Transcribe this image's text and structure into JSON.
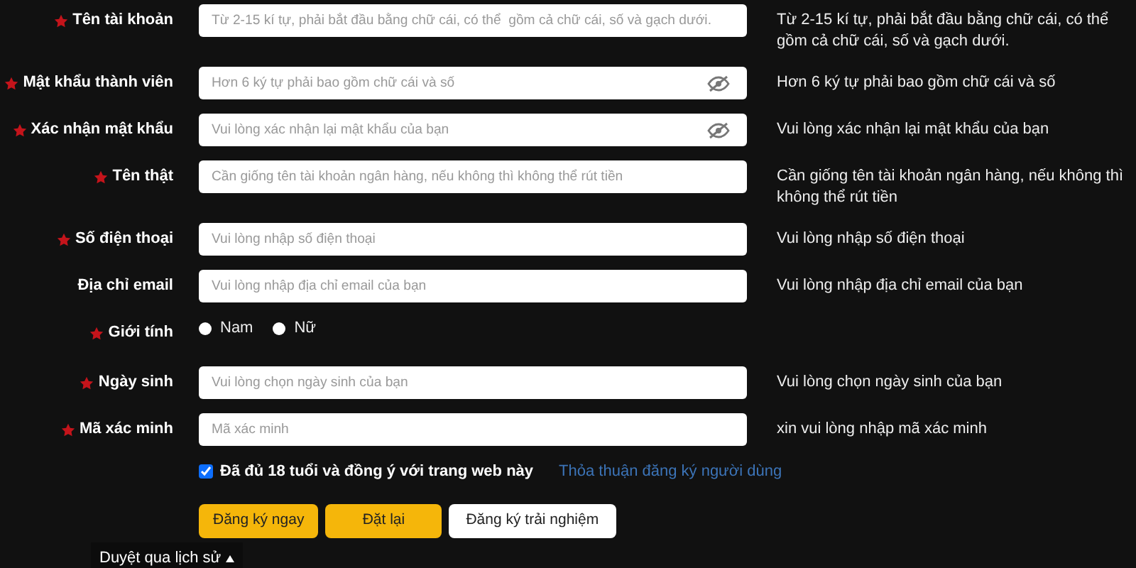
{
  "fields": [
    {
      "label": "Tên tài khoản",
      "required": true,
      "kind": "input",
      "placeholder": "Từ 2-15 kí tự, phải bắt đầu bằng chữ cái, có thể  gồm cả chữ cái, số và gạch dưới.",
      "hint": "Từ 2-15 kí tự, phải bắt đầu bằng chữ cái, có thể gồm cả chữ cái, số và gạch dưới."
    },
    {
      "label": "Mật khẩu thành viên",
      "required": true,
      "kind": "password",
      "placeholder": "Hơn 6 ký tự phải bao gồm chữ cái và số",
      "hint": "Hơn 6 ký tự phải bao gồm chữ cái và số"
    },
    {
      "label": "Xác nhận mật khẩu",
      "required": true,
      "kind": "password",
      "placeholder": "Vui lòng xác nhận lại mật khẩu của bạn",
      "hint": "Vui lòng xác nhận lại mật khẩu của bạn"
    },
    {
      "label": "Tên thật",
      "required": true,
      "kind": "input",
      "placeholder": "Cần giống tên tài khoản ngân hàng, nếu không thì không thể rút tiền",
      "hint": "Cần giống tên tài khoản ngân hàng, nếu không thì không thể rút tiền"
    },
    {
      "label": "Số điện thoại",
      "required": true,
      "kind": "input",
      "placeholder": "Vui lòng nhập số điện thoại",
      "hint": "Vui lòng nhập số điện thoại"
    },
    {
      "label": "Địa chỉ email",
      "required": false,
      "kind": "input",
      "placeholder": "Vui lòng nhập địa chỉ email của bạn",
      "hint": "Vui lòng nhập địa chỉ email của bạn"
    },
    {
      "label": "Giới tính",
      "required": true,
      "kind": "radio",
      "options": [
        {
          "label": "Nam",
          "selected": false
        },
        {
          "label": "Nữ",
          "selected": false
        }
      ]
    },
    {
      "label": "Ngày sinh",
      "required": true,
      "kind": "input",
      "placeholder": "Vui lòng chọn ngày sinh của bạn",
      "hint": "Vui lòng chọn ngày sinh của bạn"
    },
    {
      "label": "Mã xác minh",
      "required": true,
      "kind": "input",
      "placeholder": "Mã xác minh",
      "hint": "xin vui lòng nhập mã xác minh"
    }
  ],
  "agreement": {
    "checked": true,
    "text": "Đã đủ 18 tuổi và đồng ý với trang web này",
    "link": "Thỏa thuận đăng ký người dùng"
  },
  "buttons": [
    {
      "label": "Đăng ký ngay",
      "kind": "primary"
    },
    {
      "label": "Đặt lại",
      "kind": "primary"
    },
    {
      "label": "Đăng ký trải nghiệm",
      "kind": "secondary"
    }
  ],
  "footer": {
    "label": "Duyệt qua lịch sử"
  }
}
